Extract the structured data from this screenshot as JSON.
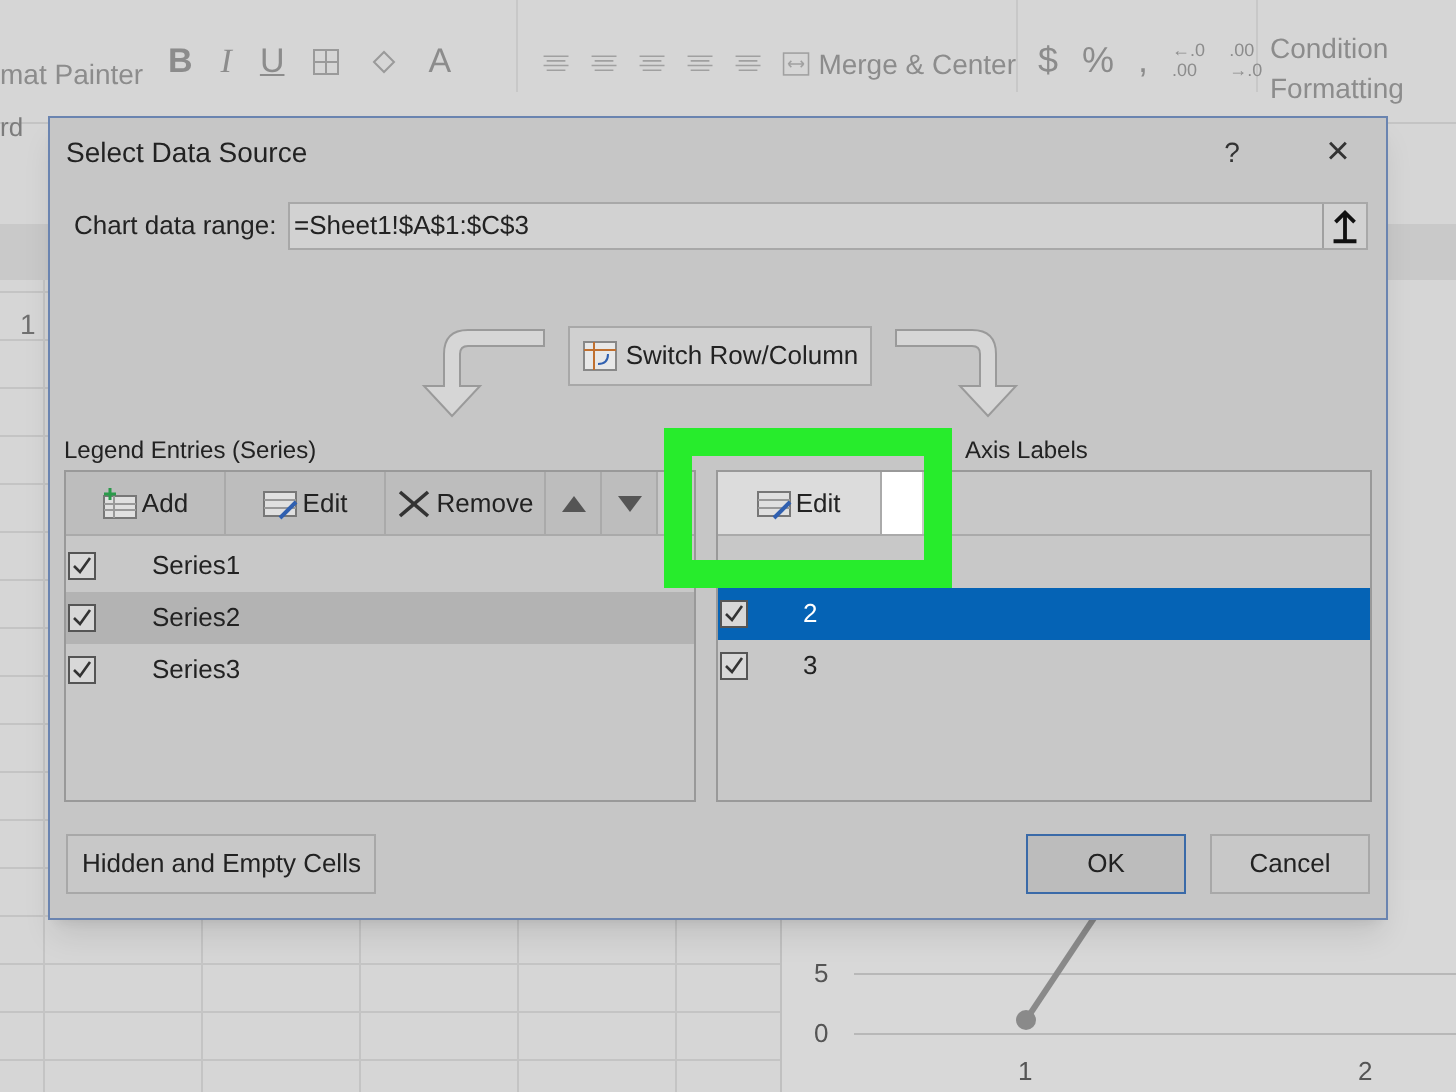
{
  "ribbon": {
    "clipboard": [
      "mat Painter",
      "rd"
    ],
    "font_buttons": [
      "B",
      "I",
      "U",
      "A"
    ],
    "merge_button": "Merge & Center",
    "number_buttons": [
      "$",
      "%",
      ","
    ],
    "decimal_buttons": [
      {
        "top": "←.0",
        "bottom": ".00"
      },
      {
        "top": ".00",
        "bottom": "→.0"
      }
    ],
    "conditional_formatting": [
      "Condition",
      "Formatting"
    ]
  },
  "sheet": {
    "row_header": "1"
  },
  "chart": {
    "y_labels": [
      "5",
      "0"
    ],
    "x_labels": [
      "1",
      "2"
    ]
  },
  "dialog": {
    "title": "Select Data Source",
    "help": "?",
    "close": "×",
    "range_label": "Chart data range:",
    "range_value": "=Sheet1!$A$1:$C$3",
    "switch_button": "Switch Row/Column",
    "legend": {
      "title": "Legend Entries (Series)",
      "buttons": [
        {
          "kind": "add",
          "label": "Add"
        },
        {
          "kind": "edit",
          "label": "Edit"
        },
        {
          "kind": "remove",
          "label": "Remove"
        },
        {
          "kind": "up"
        },
        {
          "kind": "down"
        }
      ],
      "items": [
        {
          "label": "Series1",
          "checked": true,
          "selected": false
        },
        {
          "label": "Series2",
          "checked": true,
          "selected": true
        },
        {
          "label": "Series3",
          "checked": true,
          "selected": false
        }
      ]
    },
    "axis": {
      "title": "Axis Labels",
      "edit_button": "Edit",
      "items": [
        {
          "label": "2",
          "checked": true,
          "selected": true
        },
        {
          "label": "3",
          "checked": true,
          "selected": false
        }
      ]
    },
    "hidden_cells_button": "Hidden and Empty Cells",
    "ok_button": "OK",
    "cancel_button": "Cancel"
  }
}
